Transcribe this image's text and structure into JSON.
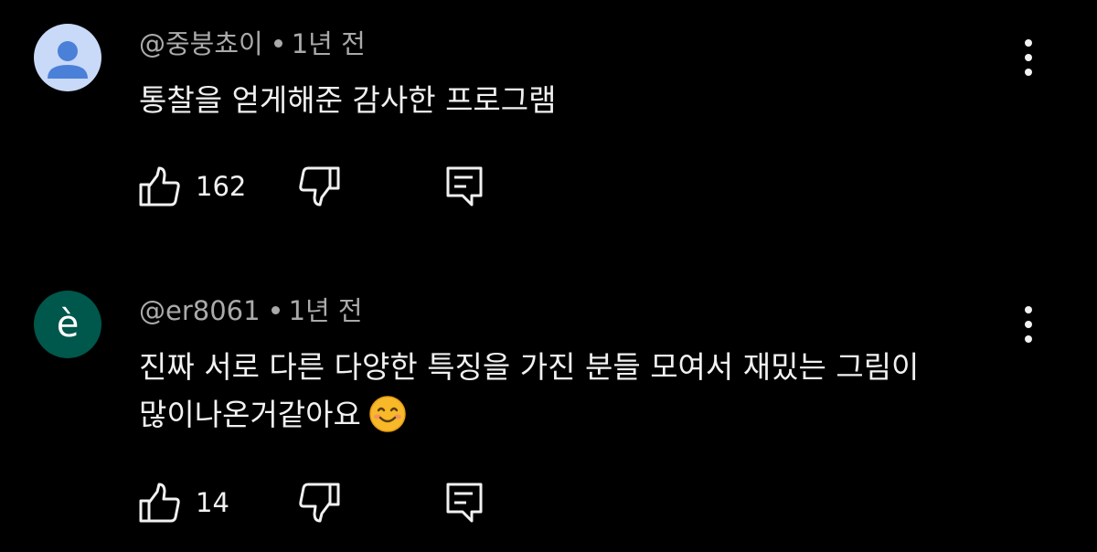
{
  "comments": [
    {
      "author": "@중붕쵸이",
      "time": "1년 전",
      "lines": [
        "통찰을 얻게해준 감사한 프로그램"
      ],
      "likes": "162",
      "avatar": {
        "type": "default-person",
        "color": "#c9d9f8"
      }
    },
    {
      "author": "@er8061",
      "time": "1년 전",
      "lines": [
        "진짜 서로 다른 다양한 특징을 가진 분들 모여서 재밌는 그림이",
        "많이나온거같아요"
      ],
      "emoji": "smiling-face-icon",
      "likes": "14",
      "avatar": {
        "type": "letter",
        "letter": "è",
        "color": "#00574b"
      }
    }
  ],
  "icons": {
    "like": "thumbs-up-icon",
    "dislike": "thumbs-down-icon",
    "reply": "reply-comment-icon",
    "menu": "more-vert-icon"
  },
  "colors": {
    "background": "#000000",
    "text": "#f1f1f1",
    "meta": "#aaaaaa"
  }
}
